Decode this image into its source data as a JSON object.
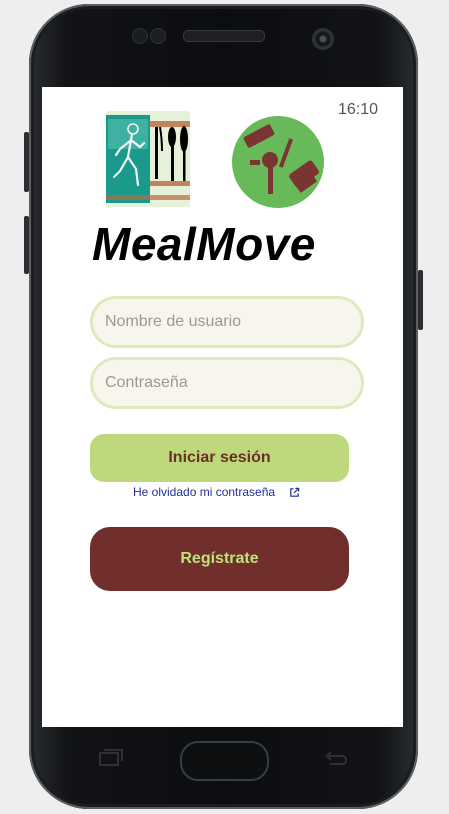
{
  "status_bar": {
    "time": "16:10"
  },
  "app": {
    "name": "MealMove"
  },
  "login_form": {
    "username_placeholder": "Nombre de usuario",
    "username_value": "",
    "password_placeholder": "Contraseña",
    "password_value": "",
    "login_button_label": "Iniciar sesión",
    "forgot_password_label": "He olvidado mi contraseña",
    "register_button_label": "Regístrate"
  },
  "icons": {
    "logo_left": "runner-and-cutlery-logo-icon",
    "logo_right": "cooking-utensils-logo-icon",
    "forgot_link": "external-link-icon"
  },
  "colors": {
    "accent_green": "#bdd97b",
    "accent_maroon": "#702f2d",
    "input_border": "#dfe9c0",
    "input_background": "#f8f6ec",
    "link_blue": "#1f2f9c",
    "logo_circle_green": "#67b95a"
  }
}
